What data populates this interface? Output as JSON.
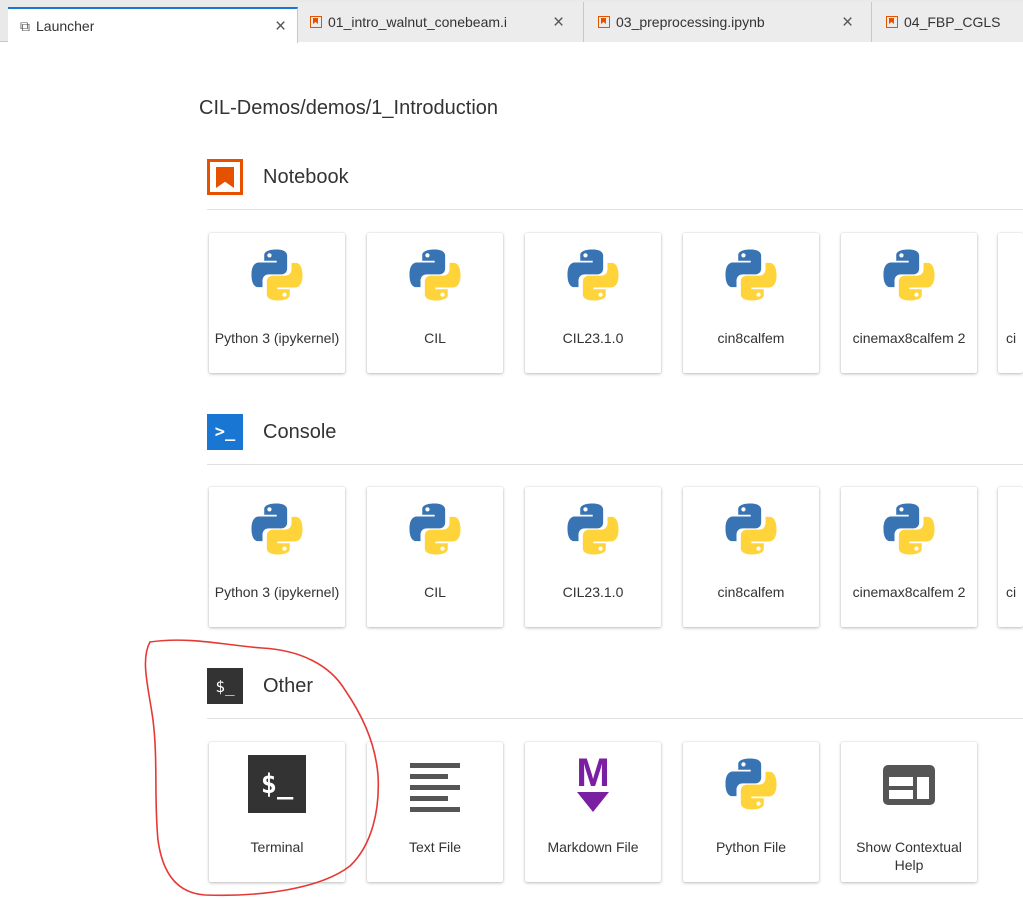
{
  "tabs": [
    {
      "label": "Launcher",
      "icon": "launcher-icon",
      "active": true
    },
    {
      "label": "01_intro_walnut_conebeam.i",
      "icon": "notebook-icon"
    },
    {
      "label": "03_preprocessing.ipynb",
      "icon": "notebook-icon"
    },
    {
      "label": "04_FBP_CGLS",
      "icon": "notebook-icon"
    }
  ],
  "close_glyph": "×",
  "launcher": {
    "cwd": "CIL-Demos/demos/1_Introduction",
    "notebook": {
      "title": "Notebook",
      "kernels": [
        {
          "label": "Python 3 (ipykernel)"
        },
        {
          "label": "CIL"
        },
        {
          "label": "CIL23.1.0"
        },
        {
          "label": "cin8calfem"
        },
        {
          "label": "cinemax8calfem 2"
        },
        {
          "label": "ci"
        }
      ]
    },
    "console": {
      "title": "Console",
      "icon_text": ">_",
      "kernels": [
        {
          "label": "Python 3 (ipykernel)"
        },
        {
          "label": "CIL"
        },
        {
          "label": "CIL23.1.0"
        },
        {
          "label": "cin8calfem"
        },
        {
          "label": "cinemax8calfem 2"
        },
        {
          "label": "ci"
        }
      ]
    },
    "other": {
      "title": "Other",
      "icon_text": "$_",
      "items": [
        {
          "label": "Terminal",
          "icon": "terminal-icon",
          "icon_text": "$_"
        },
        {
          "label": "Text File",
          "icon": "text-file-icon"
        },
        {
          "label": "Markdown File",
          "icon": "markdown-icon",
          "icon_text": "M"
        },
        {
          "label": "Python File",
          "icon": "python-icon"
        },
        {
          "label": "Show Contextual Help",
          "icon": "contextual-help-icon"
        }
      ]
    }
  },
  "colors": {
    "notebook_orange": "#e65100",
    "console_blue": "#1976d2",
    "markdown_purple": "#7b1fa2",
    "annotation_red": "#e53935",
    "python_blue": "#3873b3",
    "python_yellow": "#ffd43b"
  }
}
